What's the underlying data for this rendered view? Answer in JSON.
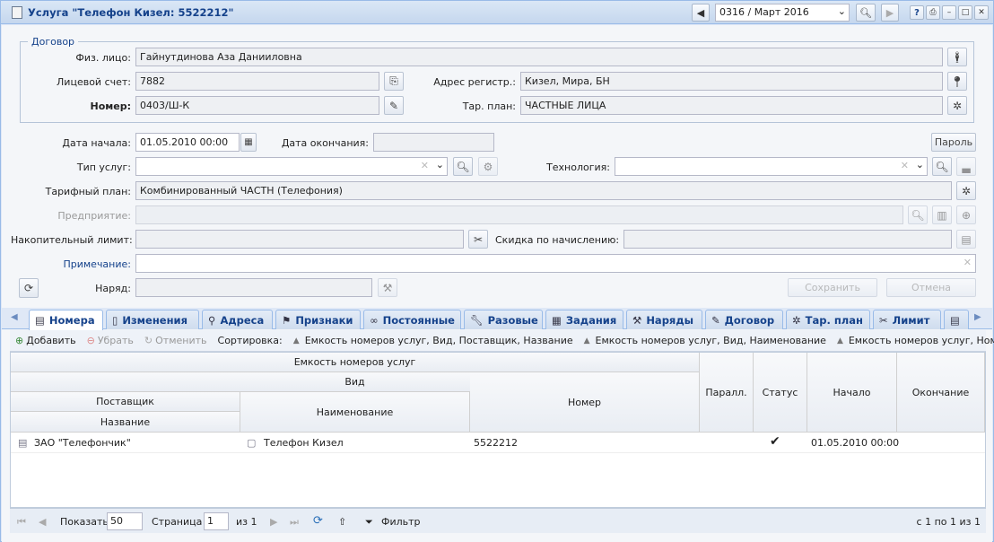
{
  "window": {
    "title": "Услуга \"Телефон Кизел: 5522212\"",
    "period": "0316 / Март 2016"
  },
  "contract": {
    "legend": "Договор",
    "person_label": "Физ. лицо:",
    "person_value": "Гайнутдинова Аза Данииловна",
    "account_label": "Лицевой счет:",
    "account_value": "7882",
    "address_label": "Адрес регистр.:",
    "address_value": "Кизел, Мира, БН",
    "number_label": "Номер:",
    "number_value": "0403/Ш-К",
    "tariff_label": "Тар. план:",
    "tariff_value": "ЧАСТНЫЕ ЛИЦА"
  },
  "form": {
    "start_label": "Дата начала:",
    "start_value": "01.05.2010 00:00",
    "end_label": "Дата окончания:",
    "end_value": "",
    "password_button": "Пароль",
    "service_type_label": "Тип услуг:",
    "service_type_value": "",
    "technology_label": "Технология:",
    "technology_value": "",
    "tariff_plan_label": "Тарифный план:",
    "tariff_plan_value": "Комбинированный ЧАСТН (Телефония)",
    "enterprise_label": "Предприятие:",
    "enterprise_value": "",
    "limit_label": "Накопительный лимит:",
    "limit_value": "",
    "discount_label": "Скидка по начислению:",
    "discount_value": "",
    "note_label": "Примечание:",
    "note_value": "",
    "order_label": "Наряд:",
    "order_value": "",
    "save_button": "Сохранить",
    "cancel_button": "Отмена"
  },
  "tabs": [
    {
      "label": "Номера",
      "icon": "phone-list-icon"
    },
    {
      "label": "Изменения",
      "icon": "doc-icon"
    },
    {
      "label": "Адреса",
      "icon": "pin-icon"
    },
    {
      "label": "Признаки",
      "icon": "tags-icon"
    },
    {
      "label": "Постоянные",
      "icon": "link-icon"
    },
    {
      "label": "Разовые",
      "icon": "wrench-icon"
    },
    {
      "label": "Задания",
      "icon": "tasks-icon"
    },
    {
      "label": "Наряды",
      "icon": "tools-icon"
    },
    {
      "label": "Договор",
      "icon": "contract-icon"
    },
    {
      "label": "Тар. план",
      "icon": "network-icon"
    },
    {
      "label": "Лимит",
      "icon": "scissors-icon"
    }
  ],
  "toolbar": {
    "add": "Добавить",
    "remove": "Убрать",
    "undo": "Отменить",
    "sort_label": "Сортировка:",
    "sort1": "Емкость номеров услуг, Вид, Поставщик, Название",
    "sort2": "Емкость номеров услуг, Вид, Наименование",
    "sort3": "Емкость номеров услуг, Номер"
  },
  "grid": {
    "group_header": "Емкость номеров услуг",
    "kind_header": "Вид",
    "supplier_header": "Поставщик",
    "name_header": "Название",
    "naming_header": "Наименование",
    "number_header": "Номер",
    "parallel_header": "Паралл.",
    "status_header": "Статус",
    "start_header": "Начало",
    "end_header": "Окончание",
    "rows": [
      {
        "supplier": "ЗАО \"Телефончик\"",
        "naming": "Телефон Кизел",
        "number": "5522212",
        "status": "✔",
        "start": "01.05.2010 00:00",
        "end": ""
      }
    ]
  },
  "pager": {
    "show_label": "Показать",
    "page_size": "50",
    "page_label": "Страница",
    "page": "1",
    "of": "из 1",
    "filter": "Фильтр",
    "summary": "с 1 по 1 из 1"
  }
}
